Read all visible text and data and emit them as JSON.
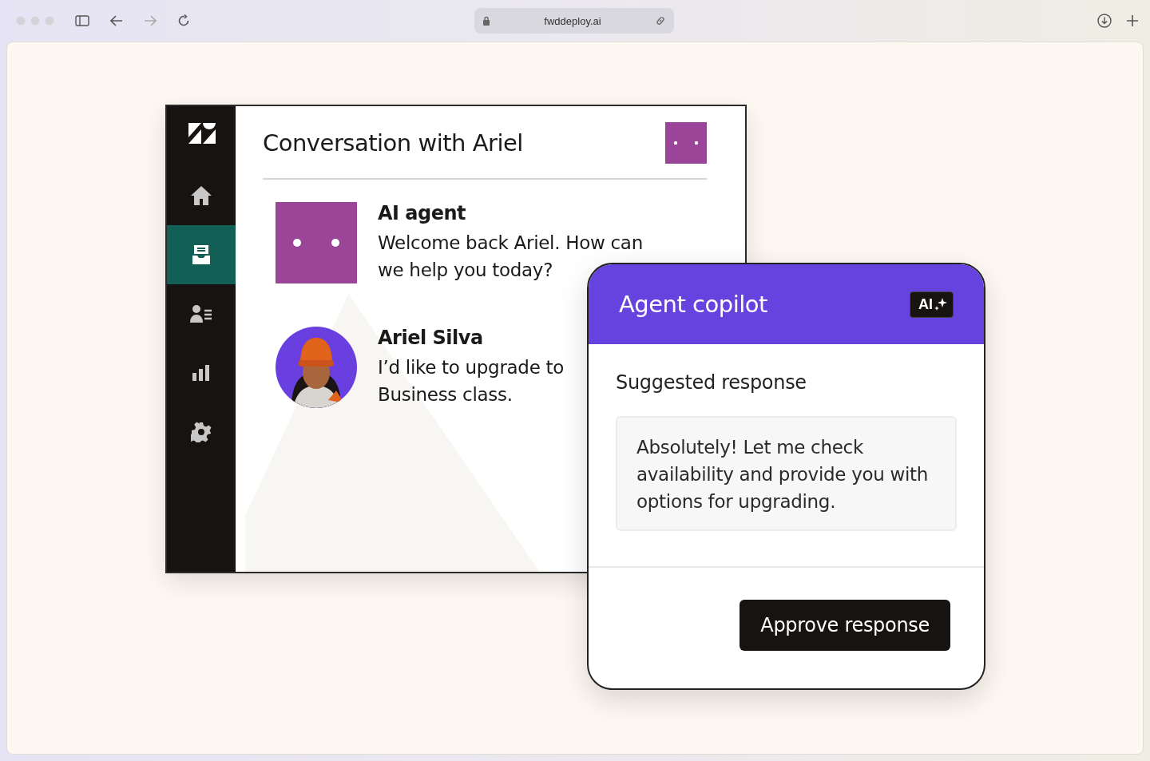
{
  "browser": {
    "url": "fwddeploy.ai"
  },
  "sidebar": {
    "items": [
      {
        "kind": "home",
        "selected": false
      },
      {
        "kind": "inbox",
        "selected": true
      },
      {
        "kind": "contacts",
        "selected": false
      },
      {
        "kind": "reports",
        "selected": false
      },
      {
        "kind": "settings",
        "selected": false
      }
    ]
  },
  "conversation": {
    "title": "Conversation with Ariel",
    "messages": [
      {
        "kind": "agent",
        "sender": "AI agent",
        "text": "Welcome back Ariel. How can we help you today?"
      },
      {
        "kind": "picture",
        "sender": "Ariel Silva",
        "text": "I’d like to upgrade to Business class."
      }
    ]
  },
  "copilot": {
    "title": "Agent copilot",
    "badge": "AI",
    "heading": "Suggested response",
    "response": "Absolutely! Let me check availability and provide you with options for upgrading.",
    "button": "Approve response"
  }
}
